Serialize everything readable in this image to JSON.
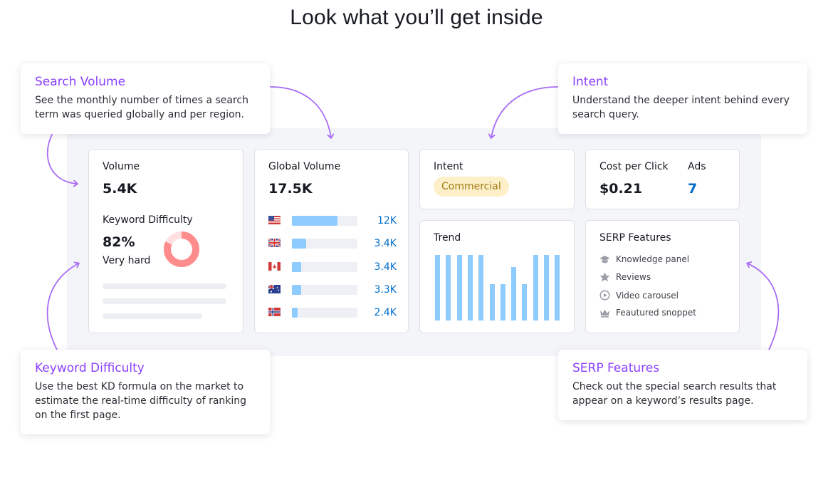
{
  "headline": "Look what you’ll get inside",
  "cards": {
    "volume": {
      "label": "Volume",
      "value": "5.4K",
      "kd_label": "Keyword Difficulty",
      "kd_value": "82%",
      "kd_text": "Very hard",
      "kd_percent": 82
    },
    "global_volume": {
      "label": "Global Volume",
      "value": "17.5K",
      "rows": [
        {
          "country": "US",
          "value": "12K",
          "fill": 0.7
        },
        {
          "country": "GB",
          "value": "3.4K",
          "fill": 0.22
        },
        {
          "country": "CA",
          "value": "3.4K",
          "fill": 0.14
        },
        {
          "country": "AU",
          "value": "3.3K",
          "fill": 0.14
        },
        {
          "country": "NO",
          "value": "2.4K",
          "fill": 0.09
        }
      ]
    },
    "intent": {
      "label": "Intent",
      "badge": "Commercial"
    },
    "cpc": {
      "cpc_label": "Cost per Click",
      "cpc_value": "$0.21",
      "ads_label": "Ads",
      "ads_value": "7"
    },
    "trend": {
      "label": "Trend",
      "values": [
        1,
        1,
        1,
        1,
        1,
        0.55,
        0.55,
        0.82,
        0.55,
        1,
        1,
        1
      ]
    },
    "serp": {
      "label": "SERP Features",
      "features": [
        {
          "icon": "graduation-cap-icon",
          "label": "Knowledge panel"
        },
        {
          "icon": "star-icon",
          "label": "Reviews"
        },
        {
          "icon": "play-circle-icon",
          "label": "Video carousel"
        },
        {
          "icon": "crown-icon",
          "label": "Feautured snoppet"
        }
      ]
    }
  },
  "callouts": {
    "search_volume": {
      "title": "Search Volume",
      "text": "See the monthly number of times a search term was queried globally and per region."
    },
    "intent": {
      "title": "Intent",
      "text": "Understand the deeper intent behind every search query."
    },
    "keyword_difficulty": {
      "title": "Keyword Difficulty",
      "text": "Use the best KD formula on the market to estimate the real-time difficulty of ranking on the first page."
    },
    "serp_features": {
      "title": "SERP Features",
      "text": "Check out the special search results that appear on a keyword’s results page."
    }
  },
  "colors": {
    "accent": "#8a3ffc",
    "bar": "#8ecbff",
    "link": "#006dca",
    "kd": "#ff8c8c",
    "badge_bg": "#fdf0c9"
  }
}
